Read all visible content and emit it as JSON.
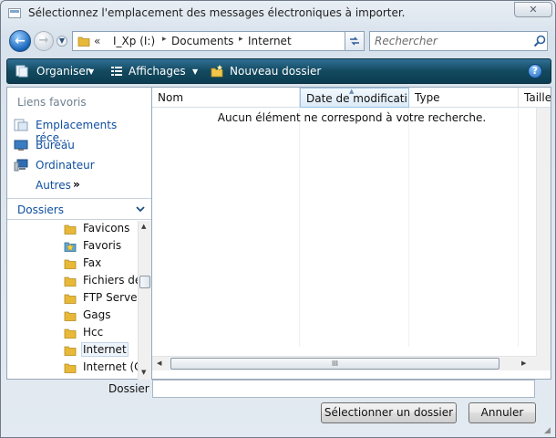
{
  "window": {
    "title": "Sélectionnez l'emplacement des messages électroniques à importer.",
    "close_glyph": "✕"
  },
  "address": {
    "more_glyph": "«",
    "crumbs": [
      "I_Xp (I:)",
      "Documents",
      "Internet"
    ],
    "separator_glyph": "▸",
    "search_placeholder": "Rechercher"
  },
  "toolbar": {
    "organise_label": "Organiser",
    "views_label": "Affichages",
    "new_folder_label": "Nouveau dossier",
    "dropdown_glyph": "▼",
    "help_glyph": "?"
  },
  "nav": {
    "favorites_header": "Liens favoris",
    "favorites": [
      {
        "label": "Emplacements réce...",
        "icon": "recent-places-icon"
      },
      {
        "label": "Bureau",
        "icon": "desktop-icon"
      },
      {
        "label": "Ordinateur",
        "icon": "computer-icon"
      }
    ],
    "more_label": "Autres",
    "more_glyph": "»",
    "folders_header": "Dossiers",
    "tree": [
      {
        "label": "Favicons",
        "icon": "folder-icon",
        "selected": false
      },
      {
        "label": "Favoris",
        "icon": "favorites-star-icon",
        "selected": false
      },
      {
        "label": "Fax",
        "icon": "folder-icon",
        "selected": false
      },
      {
        "label": "Fichiers de",
        "icon": "folder-icon",
        "selected": false
      },
      {
        "label": "FTP Server",
        "icon": "folder-icon",
        "selected": false
      },
      {
        "label": "Gags",
        "icon": "folder-icon",
        "selected": false
      },
      {
        "label": "Hcc",
        "icon": "folder-icon",
        "selected": false
      },
      {
        "label": "Internet",
        "icon": "folder-icon",
        "selected": true
      },
      {
        "label": "Internet (C",
        "icon": "folder-icon",
        "selected": false
      }
    ]
  },
  "files": {
    "columns": [
      "Nom",
      "Date de modificati...",
      "Type",
      "Taille"
    ],
    "empty_message": "Aucun élément ne correspond à votre recherche.",
    "scroll_thumb_grip": "III"
  },
  "footer": {
    "folder_label": "Dossier :",
    "folder_value": "",
    "select_button": "Sélectionner un dossier",
    "cancel_button": "Annuler"
  },
  "colors": {
    "toolbar": "#13495f",
    "link_blue": "#0f4fa0",
    "folder_yellow": "#e8b938"
  }
}
